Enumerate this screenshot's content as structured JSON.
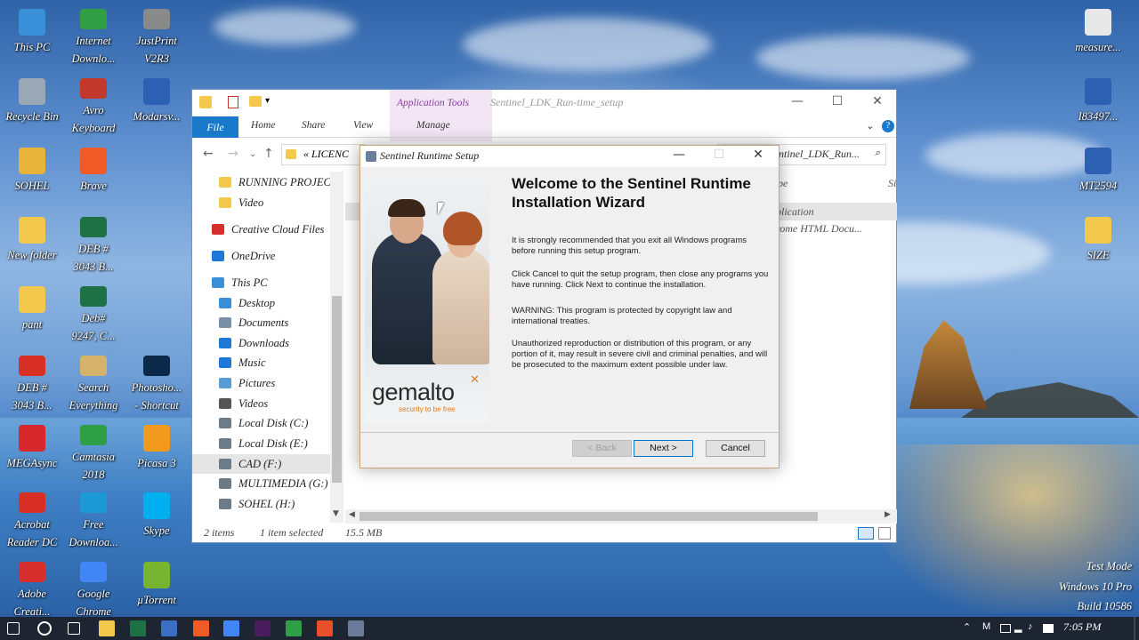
{
  "desktop": {
    "icons": [
      {
        "label": "This PC",
        "icon": "computer-icon",
        "color": "#3a8fd9"
      },
      {
        "label": "Internet\nDownlo...",
        "icon": "idm-globe-icon",
        "color": "#2f9e44"
      },
      {
        "label": "JustPrint\nV2R3",
        "icon": "printer-icon",
        "color": "#8a8a8a"
      },
      {
        "label": "Recycle Bin",
        "icon": "recycle-bin-icon",
        "color": "#9aa7b5"
      },
      {
        "label": "Avro\nKeyboard",
        "icon": "keyboard-icon",
        "color": "#c0392b"
      },
      {
        "label": "Modarsv...",
        "icon": "shortcut-icon",
        "color": "#2d5fb3"
      },
      {
        "label": "SOHEL",
        "icon": "user-folder-icon",
        "color": "#e8b53a"
      },
      {
        "label": "Brave",
        "icon": "brave-icon",
        "color": "#f05a24"
      },
      {
        "label": "New folder",
        "icon": "folder-icon",
        "color": "#f2c94c"
      },
      {
        "label": "DEB #\n3043 B...",
        "icon": "excel-icon",
        "color": "#1e7145"
      },
      {
        "label": "pant",
        "icon": "folder-icon",
        "color": "#f2c94c"
      },
      {
        "label": "Deb#\n9247, C...",
        "icon": "excel-icon",
        "color": "#1e7145"
      },
      {
        "label": "DEB #\n3043 B...",
        "icon": "pdf-icon",
        "color": "#d93025"
      },
      {
        "label": "Search\nEverything",
        "icon": "search-everything-icon",
        "color": "#d4b26a"
      },
      {
        "label": "Photosho...\n- Shortcut",
        "icon": "photoshop-icon",
        "color": "#0b2a4a"
      },
      {
        "label": "MEGAsync",
        "icon": "mega-icon",
        "color": "#d9272e"
      },
      {
        "label": "Camtasia\n2018",
        "icon": "camtasia-icon",
        "color": "#2e9e47"
      },
      {
        "label": "Picasa 3",
        "icon": "picasa-icon",
        "color": "#f29a1e"
      },
      {
        "label": "Acrobat\nReader DC",
        "icon": "acrobat-icon",
        "color": "#d93025"
      },
      {
        "label": "Free\nDownloa...",
        "icon": "download-icon",
        "color": "#1c9ad6"
      },
      {
        "label": "Skype",
        "icon": "skype-icon",
        "color": "#00aff0"
      },
      {
        "label": "Adobe\nCreati...",
        "icon": "creative-cloud-icon",
        "color": "#d62d2d"
      },
      {
        "label": "Google\nChrome",
        "icon": "chrome-icon",
        "color": "#4285f4"
      },
      {
        "label": "µTorrent",
        "icon": "utorrent-icon",
        "color": "#77b530"
      },
      {
        "label": "measure...",
        "icon": "file-icon",
        "color": "#e8e8e8"
      },
      {
        "label": "I83497...",
        "icon": "shortcut-icon",
        "color": "#2d5fb3"
      },
      {
        "label": "MT2594",
        "icon": "shortcut-icon",
        "color": "#2d5fb3"
      },
      {
        "label": "SIZE",
        "icon": "folder-icon",
        "color": "#f2c94c"
      }
    ],
    "watermark": [
      "Test Mode",
      "Windows 10 Pro",
      "Build 10586"
    ]
  },
  "explorer": {
    "title": "Sentinel_LDK_Run-time_setup",
    "app_tools": "Application Tools",
    "tabs": {
      "file": "File",
      "home": "Home",
      "share": "Share",
      "view": "View",
      "manage": "Manage"
    },
    "address": "LICENC",
    "address_prefix": "«",
    "search_text": "ntinel_LDK_Run...",
    "nav": [
      {
        "label": "RUNNING PROJEC",
        "icon": "folder-icon",
        "color": "#f2c94c"
      },
      {
        "label": "Video",
        "icon": "folder-icon",
        "color": "#f2c94c"
      },
      {
        "label": "Creative Cloud Files",
        "icon": "creative-cloud-icon",
        "color": "#d62d2d"
      },
      {
        "label": "OneDrive",
        "icon": "onedrive-icon",
        "color": "#1e78d6"
      },
      {
        "label": "This PC",
        "icon": "computer-icon",
        "color": "#3a8fd9"
      },
      {
        "label": "Desktop",
        "icon": "desktop-icon",
        "color": "#3a8fd9"
      },
      {
        "label": "Documents",
        "icon": "documents-icon",
        "color": "#7a8fa8"
      },
      {
        "label": "Downloads",
        "icon": "downloads-icon",
        "color": "#1e78d6"
      },
      {
        "label": "Music",
        "icon": "music-icon",
        "color": "#1e78d6"
      },
      {
        "label": "Pictures",
        "icon": "pictures-icon",
        "color": "#5a9bd5"
      },
      {
        "label": "Videos",
        "icon": "videos-icon",
        "color": "#555555"
      },
      {
        "label": "Local Disk (C:)",
        "icon": "drive-icon",
        "color": "#6d7a88"
      },
      {
        "label": "Local Disk (E:)",
        "icon": "drive-icon",
        "color": "#6d7a88"
      },
      {
        "label": "CAD (F:)",
        "icon": "drive-icon",
        "color": "#6d7a88"
      },
      {
        "label": "MULTIMEDIA (G:)",
        "icon": "drive-icon",
        "color": "#6d7a88"
      },
      {
        "label": "SOHEL (H:)",
        "icon": "drive-icon",
        "color": "#6d7a88"
      }
    ],
    "columns": {
      "type": "pe",
      "size": "Si"
    },
    "rows": [
      "plication",
      "rome HTML Docu..."
    ],
    "status": {
      "items": "2 items",
      "selected": "1 item selected",
      "size": "15.5 MB"
    }
  },
  "dialog": {
    "title": "Sentinel Runtime Setup",
    "heading": "Welcome to the Sentinel Runtime Installation Wizard",
    "paragraphs": [
      "It is strongly recommended that you exit all Windows programs before running this setup program.",
      "Click Cancel to quit the setup program, then close any programs you have running.  Click Next to continue the installation.",
      "WARNING: This program is protected by copyright law and international treaties.",
      "Unauthorized reproduction or distribution of this program, or any portion of it, may result in severe civil and criminal penalties, and will be prosecuted to the maximum extent possible under law."
    ],
    "brand": "gemalto",
    "brand_tagline": "security to be free",
    "buttons": {
      "back": "< Back",
      "next": "Next >",
      "cancel": "Cancel"
    }
  },
  "taskbar": {
    "time": "7:05 PM",
    "lang": "M",
    "apps": [
      {
        "icon": "start-icon",
        "color": "#ffffff"
      },
      {
        "icon": "cortana-icon",
        "color": "#ffffff"
      },
      {
        "icon": "task-view-icon",
        "color": "#ffffff"
      },
      {
        "icon": "file-explorer-icon",
        "color": "#f2c94c"
      },
      {
        "icon": "excel-icon",
        "color": "#1e7145"
      },
      {
        "icon": "word-icon",
        "color": "#3a6fc4"
      },
      {
        "icon": "brave-icon",
        "color": "#f05a24"
      },
      {
        "icon": "chrome-icon",
        "color": "#4285f4"
      },
      {
        "icon": "premiere-icon",
        "color": "#4a1d5e"
      },
      {
        "icon": "camtasia-icon",
        "color": "#2e9e47"
      },
      {
        "icon": "camtasia-recorder-icon",
        "color": "#e8502c"
      },
      {
        "icon": "setup-icon",
        "color": "#6a7c9a"
      }
    ]
  }
}
